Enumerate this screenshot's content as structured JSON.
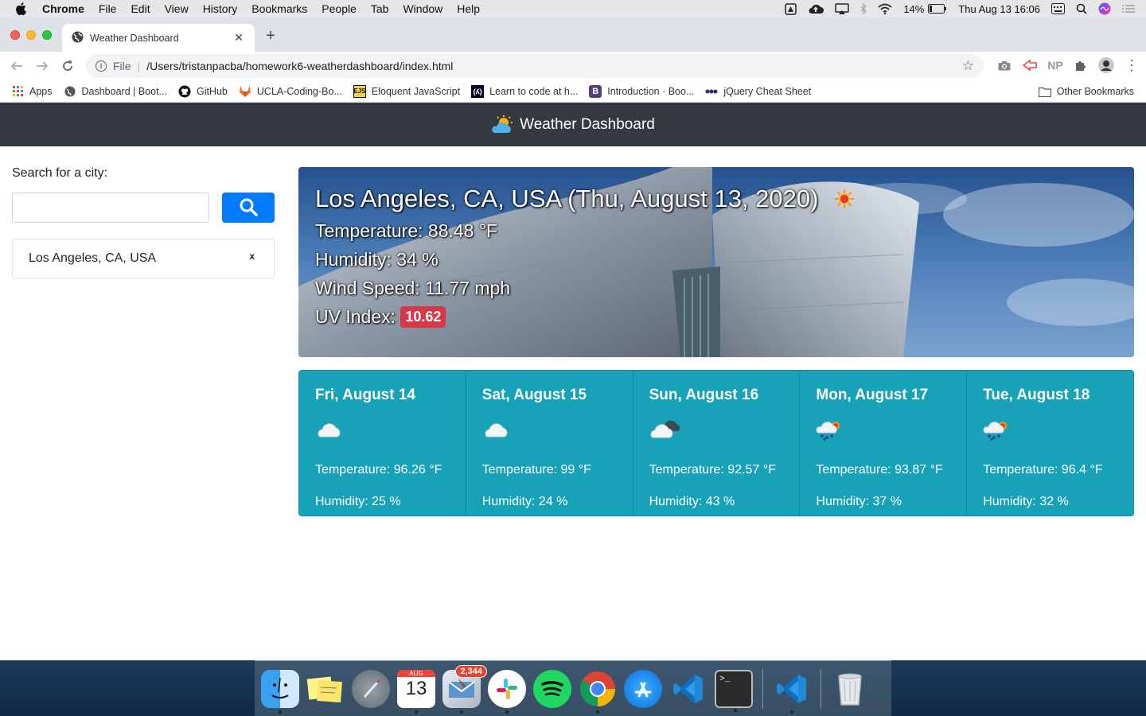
{
  "menubar": {
    "app": "Chrome",
    "items": [
      "File",
      "Edit",
      "View",
      "History",
      "Bookmarks",
      "People",
      "Tab",
      "Window",
      "Help"
    ],
    "battery": "14%",
    "datetime": "Thu Aug 13  16:06"
  },
  "browser": {
    "tab_title": "Weather Dashboard",
    "url_scheme": "File",
    "url": "/Users/tristanpacba/homework6-weatherdashboard/index.html",
    "bookmarks": [
      "Apps",
      "Dashboard | Boot...",
      "GitHub",
      "UCLA-Coding-Bo...",
      "Eloquent JavaScript",
      "Learn to code at h...",
      "Introduction · Boo...",
      "jQuery Cheat Sheet"
    ],
    "other_bookmarks": "Other Bookmarks"
  },
  "app": {
    "title": "Weather Dashboard",
    "search_label": "Search for a city:",
    "search_value": "",
    "history": [
      {
        "city": "Los Angeles, CA, USA",
        "remove": "x"
      }
    ]
  },
  "current": {
    "heading": "Los Angeles, CA, USA (Thu, August 13, 2020)",
    "temperature": "Temperature: 88.48 °F",
    "humidity": "Humidity: 34 %",
    "wind": "Wind Speed: 11.77 mph",
    "uv_label": "UV Index:",
    "uv_value": "10.62",
    "icon": "sun-icon"
  },
  "forecast": [
    {
      "date": "Fri, August 14",
      "icon": "cloud-icon",
      "temp": "Temperature: 96.26 °F",
      "humidity": "Humidity: 25 %"
    },
    {
      "date": "Sat, August 15",
      "icon": "cloud-icon",
      "temp": "Temperature: 99 °F",
      "humidity": "Humidity: 24 %"
    },
    {
      "date": "Sun, August 16",
      "icon": "broken-clouds-icon",
      "temp": "Temperature: 92.57 °F",
      "humidity": "Humidity: 43 %"
    },
    {
      "date": "Mon, August 17",
      "icon": "rain-icon",
      "temp": "Temperature: 93.87 °F",
      "humidity": "Humidity: 37 %"
    },
    {
      "date": "Tue, August 18",
      "icon": "rain-icon",
      "temp": "Temperature: 96.4 °F",
      "humidity": "Humidity: 32 %"
    }
  ],
  "dock": {
    "apps": [
      "Finder",
      "Stickies",
      "Launchpad",
      "Calendar",
      "Mail",
      "Slack",
      "Spotify",
      "Chrome",
      "App Store",
      "VS Code",
      "Terminal",
      "VS Code",
      "Trash"
    ],
    "calendar_month": "AUG",
    "calendar_day": "13",
    "mail_badge": "2,344"
  },
  "colors": {
    "navbar": "#343a40",
    "primary": "#007bff",
    "info": "#17a2b8",
    "danger": "#dc3545"
  }
}
